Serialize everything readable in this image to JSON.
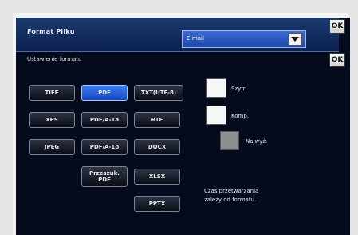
{
  "header": {
    "title": "Format Pliku",
    "select_value": "E-mail",
    "ok_label": "OK"
  },
  "section": {
    "title": "Ustawienie formatu",
    "ok_label": "OK"
  },
  "formats": {
    "tiff": "TIFF",
    "pdf": "PDF",
    "txt": "TXT(UTF-8)",
    "xps": "XPS",
    "pdfa1a": "PDF/A-1a",
    "rtf": "RTF",
    "jpeg": "JPEG",
    "pdfa1b": "PDF/A-1b",
    "docx": "DOCX",
    "compact_pdf": "Przeszuk. PDF",
    "xlsx": "XLSX",
    "pptx": "PPTX",
    "selected": "PDF"
  },
  "options": {
    "encrypt_label": "Szyfr.",
    "compress_label": "Komp.",
    "highest_label": "Najwyż."
  },
  "note": {
    "line1": "Czas przetwarzania",
    "line2": "zależy od formatu."
  }
}
